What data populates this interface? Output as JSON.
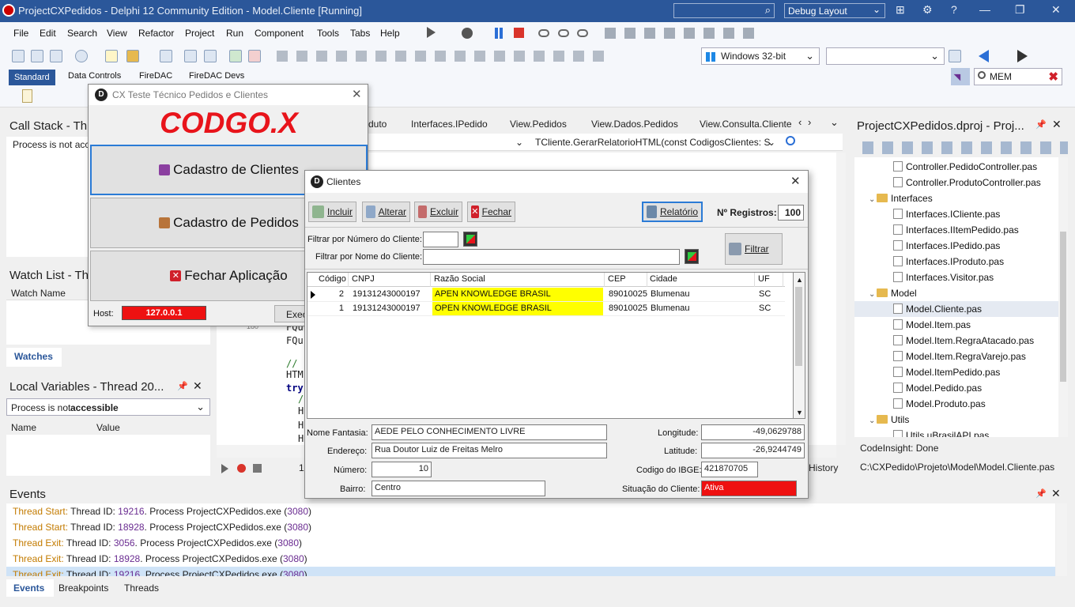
{
  "titlebar": {
    "title": "ProjectCXPedidos - Delphi 12 Community Edition - Model.Cliente [Running]",
    "layout": "Debug Layout",
    "layout_arrow": "⌄",
    "search_icon": "⌕",
    "btn_layout_icon": "⊞",
    "btn_settings_icon": "⚙",
    "btn_help_icon": "?",
    "btn_minimize_icon": "—",
    "btn_restore_icon": "❐",
    "btn_close_icon": "✕"
  },
  "menu": [
    "File",
    "Edit",
    "Search",
    "View",
    "Refactor",
    "Project",
    "Run",
    "Component",
    "Tools",
    "Tabs",
    "Help"
  ],
  "toolbar": {
    "platform": "Windows 32-bit",
    "config": "",
    "dropdown_arrow": "⌄"
  },
  "palette": {
    "tabs": [
      "Standard",
      "Data Controls",
      "FireDAC",
      "FireDAC Devs"
    ],
    "search_value": "MEM",
    "search_clear_icon": "✖"
  },
  "editor": {
    "tabs": [
      "duto",
      "Interfaces.IPedido",
      "View.Pedidos",
      "View.Dados.Pedidos",
      "View.Consulta.Cliente"
    ],
    "method": "TCliente.GerarRelatorioHTML(const CodigosClientes: S",
    "lines": [
      "FQu",
      "FQu",
      "// ",
      "HTM",
      "try",
      "/",
      "H",
      "H",
      "H"
    ],
    "line_no": "180",
    "history": "History",
    "page": "1"
  },
  "callstack": {
    "title": "Call Stack - Thr",
    "text": "Process is not acce"
  },
  "watchlist": {
    "title": "Watch List - Th",
    "column": "Watch Name",
    "tab": "Watches"
  },
  "localvars": {
    "title": "Local Variables - Thread 20...",
    "combo_prefix": "Process is not ",
    "combo_bold": "accessible",
    "col_name": "Name",
    "col_value": "Value",
    "pin_icon": "📌",
    "close_icon": "✕"
  },
  "project": {
    "title": "ProjectCXPedidos.dproj - Proj...",
    "items": [
      {
        "label": "Controller.PedidoController.pas",
        "type": "file",
        "level": 2
      },
      {
        "label": "Controller.ProdutoController.pas",
        "type": "file",
        "level": 2
      },
      {
        "label": "Interfaces",
        "type": "folder",
        "level": 1
      },
      {
        "label": "Interfaces.ICliente.pas",
        "type": "file",
        "level": 2
      },
      {
        "label": "Interfaces.IItemPedido.pas",
        "type": "file",
        "level": 2
      },
      {
        "label": "Interfaces.IPedido.pas",
        "type": "file",
        "level": 2
      },
      {
        "label": "Interfaces.IProduto.pas",
        "type": "file",
        "level": 2
      },
      {
        "label": "Interfaces.Visitor.pas",
        "type": "file",
        "level": 2
      },
      {
        "label": "Model",
        "type": "folder",
        "level": 1
      },
      {
        "label": "Model.Cliente.pas",
        "type": "file",
        "level": 2,
        "selected": true
      },
      {
        "label": "Model.Item.pas",
        "type": "file",
        "level": 2
      },
      {
        "label": "Model.Item.RegraAtacado.pas",
        "type": "file",
        "level": 2
      },
      {
        "label": "Model.Item.RegraVarejo.pas",
        "type": "file",
        "level": 2
      },
      {
        "label": "Model.ItemPedido.pas",
        "type": "file",
        "level": 2
      },
      {
        "label": "Model.Pedido.pas",
        "type": "file",
        "level": 2
      },
      {
        "label": "Model.Produto.pas",
        "type": "file",
        "level": 2
      },
      {
        "label": "Utils",
        "type": "folder",
        "level": 1
      },
      {
        "label": "Utils.uBrasilAPI.pas",
        "type": "file",
        "level": 2
      }
    ],
    "status": "CodeInsight: Done",
    "path": "C:\\CXPedido\\Projeto\\Model\\Model.Cliente.pas"
  },
  "events": {
    "title": "Events",
    "lines": [
      {
        "kind": "Thread Start:",
        "pre": " Thread ID: ",
        "tid": "19216",
        "mid": ". Process ProjectCXPedidos.exe (",
        "pid": "3080",
        "end": ")"
      },
      {
        "kind": "Thread Start:",
        "pre": " Thread ID: ",
        "tid": "18928",
        "mid": ". Process ProjectCXPedidos.exe (",
        "pid": "3080",
        "end": ")"
      },
      {
        "kind": "Thread Exit:",
        "pre": " Thread ID: ",
        "tid": "3056",
        "mid": ". Process ProjectCXPedidos.exe (",
        "pid": "3080",
        "end": ")"
      },
      {
        "kind": "Thread Exit:",
        "pre": " Thread ID: ",
        "tid": "18928",
        "mid": ". Process ProjectCXPedidos.exe (",
        "pid": "3080",
        "end": ")"
      },
      {
        "kind": "Thread Exit:",
        "pre": " Thread ID: ",
        "tid": "19216",
        "mid": ". Process ProjectCXPedidos.exe (",
        "pid": "3080",
        "end": ")"
      }
    ],
    "tabs": [
      "Events",
      "Breakpoints",
      "Threads"
    ]
  },
  "cx": {
    "title": "CX Teste Técnico Pedidos e Clientes",
    "logo": "CODGO.X",
    "btn_clientes": "Cadastro de Clientes",
    "btn_pedidos": "Cadastro de Pedidos",
    "btn_fechar": "Fechar Aplicação",
    "host_label": "Host:",
    "host_value": "127.0.0.1",
    "exec": "Exec"
  },
  "clientes": {
    "title": "Clientes",
    "btn_incluir": "Incluir",
    "btn_alterar": "Alterar",
    "btn_excluir": "Excluir",
    "btn_fechar": "Fechar",
    "btn_relatorio": "Relatório",
    "nregs_label": "Nº Registros:",
    "nregs_value": "100",
    "filtro_num_label": "Filtrar por Número do Cliente:",
    "filtro_nome_label": "Filtrar por Nome do Cliente:",
    "btn_filtrar": "Filtrar",
    "columns": [
      "Código",
      "CNPJ",
      "Razão Social",
      "CEP",
      "Cidade",
      "UF"
    ],
    "rows": [
      {
        "codigo": "2",
        "cnpj": "19131243000197",
        "razao": "APEN KNOWLEDGE BRASIL",
        "cep": "89010025",
        "cidade": "Blumenau",
        "uf": "SC"
      },
      {
        "codigo": "1",
        "cnpj": "19131243000197",
        "razao": "OPEN KNOWLEDGE BRASIL",
        "cep": "89010025",
        "cidade": "Blumenau",
        "uf": "SC"
      }
    ],
    "fantasia_label": "Nome Fantasia:",
    "fantasia_value": "AEDE PELO CONHECIMENTO LIVRE",
    "endereco_label": "Endereço:",
    "endereco_value": "Rua Doutor Luiz de Freitas Melro",
    "numero_label": "Número:",
    "numero_value": "10",
    "bairro_label": "Bairro:",
    "bairro_value": "Centro",
    "longitude_label": "Longitude:",
    "longitude_value": "-49,0629788",
    "latitude_label": "Latitude:",
    "latitude_value": "-26,9244749",
    "ibge_label": "Codigo do IBGE:",
    "ibge_value": "421870705",
    "situacao_label": "Situação do Cliente:",
    "situacao_value": "Ativa"
  }
}
